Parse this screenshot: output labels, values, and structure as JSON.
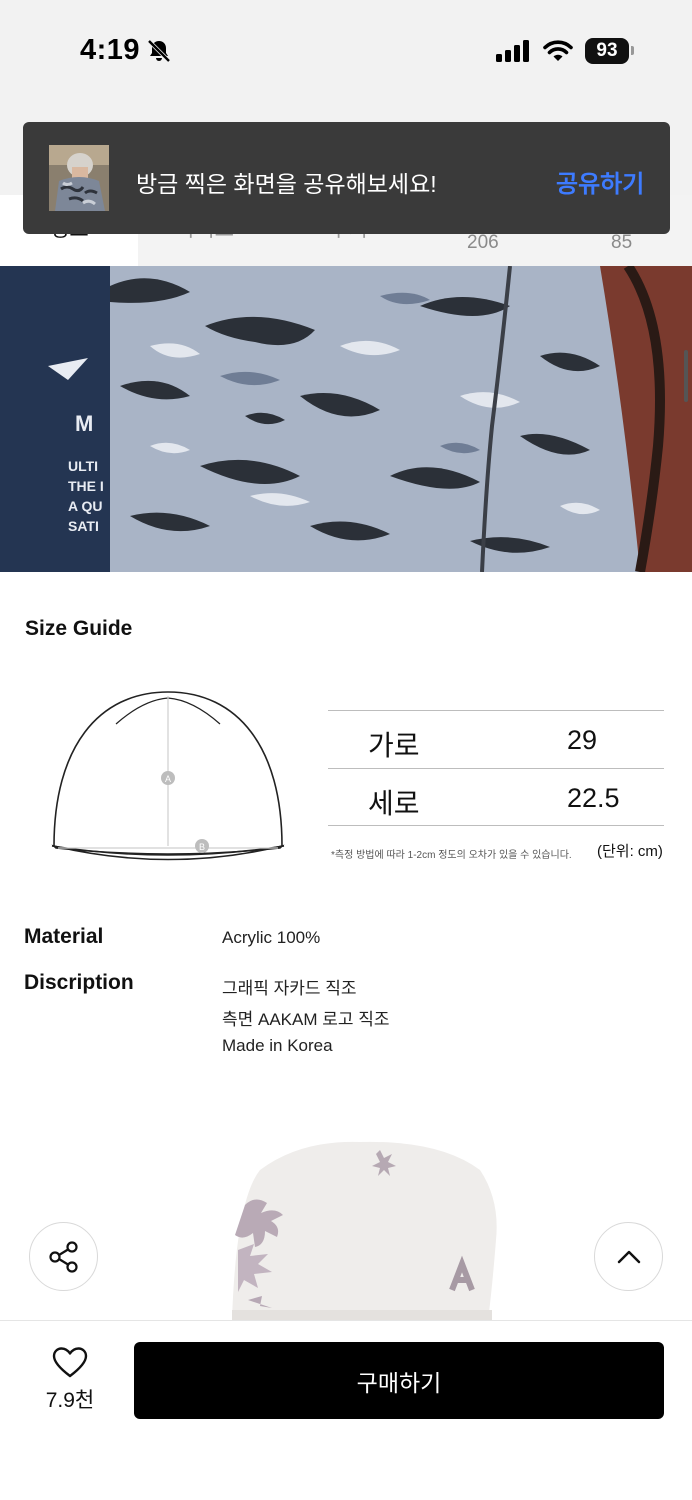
{
  "status_bar": {
    "time": "4:19",
    "battery": "93",
    "icons": [
      "bell-slash-icon",
      "cellular-signal-icon",
      "wifi-icon",
      "battery-icon"
    ]
  },
  "tabs": {
    "partial_labels": [
      "정보",
      "사이즈",
      "후기"
    ],
    "counts": [
      "206",
      "85"
    ]
  },
  "toast": {
    "message": "방금 찍은 화면을 공유해보세요!",
    "action": "공유하기"
  },
  "size_guide": {
    "title": "Size Guide",
    "rows": [
      {
        "label": "가로",
        "value": "29"
      },
      {
        "label": "세로",
        "value": "22.5"
      }
    ],
    "diagram_markers": [
      "A",
      "B"
    ],
    "note": "*측정 방법에 따라 1-2cm 정도의 오차가 있을 수 있습니다.",
    "unit": "(단위: cm)"
  },
  "info": {
    "material_label": "Material",
    "material_value": "Acrylic 100%",
    "description_label": "Discription",
    "description_lines": [
      "그래픽 자카드 직조",
      "측면 AAKAM 로고 직조",
      "Made in Korea"
    ]
  },
  "photo_text": {
    "shirt_lines": [
      "ULTI",
      "THE I",
      "A QU",
      "SATI"
    ],
    "shirt_logo": "M"
  },
  "bottom": {
    "like_count": "7.9천",
    "buy_label": "구매하기"
  },
  "colors": {
    "accent": "#3d7bff",
    "toast_bg": "#3a3a3a",
    "buy_bg": "#000000"
  }
}
